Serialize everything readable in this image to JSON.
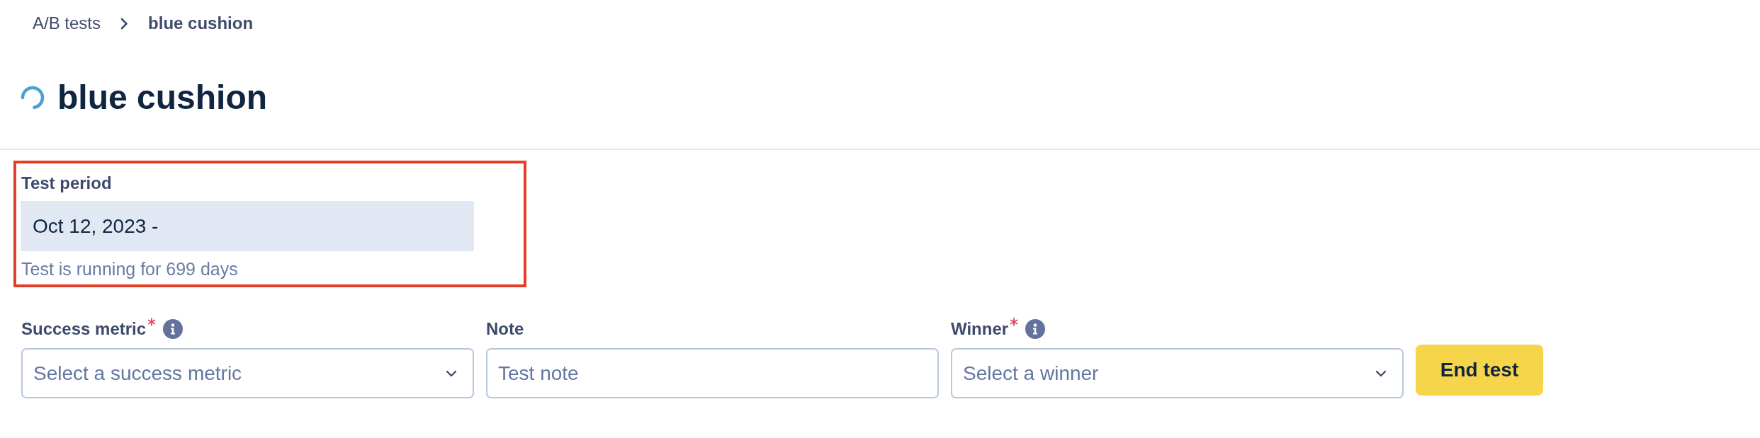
{
  "breadcrumb": [
    {
      "label": "A/B tests",
      "current": false
    },
    {
      "label": "blue cushion",
      "current": true
    }
  ],
  "header": {
    "title": "blue cushion",
    "loading": true
  },
  "test_period": {
    "label": "Test period",
    "value": "Oct 12, 2023 -",
    "disabled": true,
    "hint": "Test is running for 699 days",
    "highlighted": true
  },
  "fields": [
    {
      "kind": "select",
      "label": "Success metric",
      "required": true,
      "info": true,
      "placeholder": "Select a success metric"
    },
    {
      "kind": "text",
      "label": "Note",
      "required": false,
      "info": false,
      "placeholder": "Test note"
    },
    {
      "kind": "select",
      "label": "Winner",
      "required": true,
      "info": true,
      "placeholder": "Select a winner"
    }
  ],
  "end_button": {
    "label": "End test"
  }
}
